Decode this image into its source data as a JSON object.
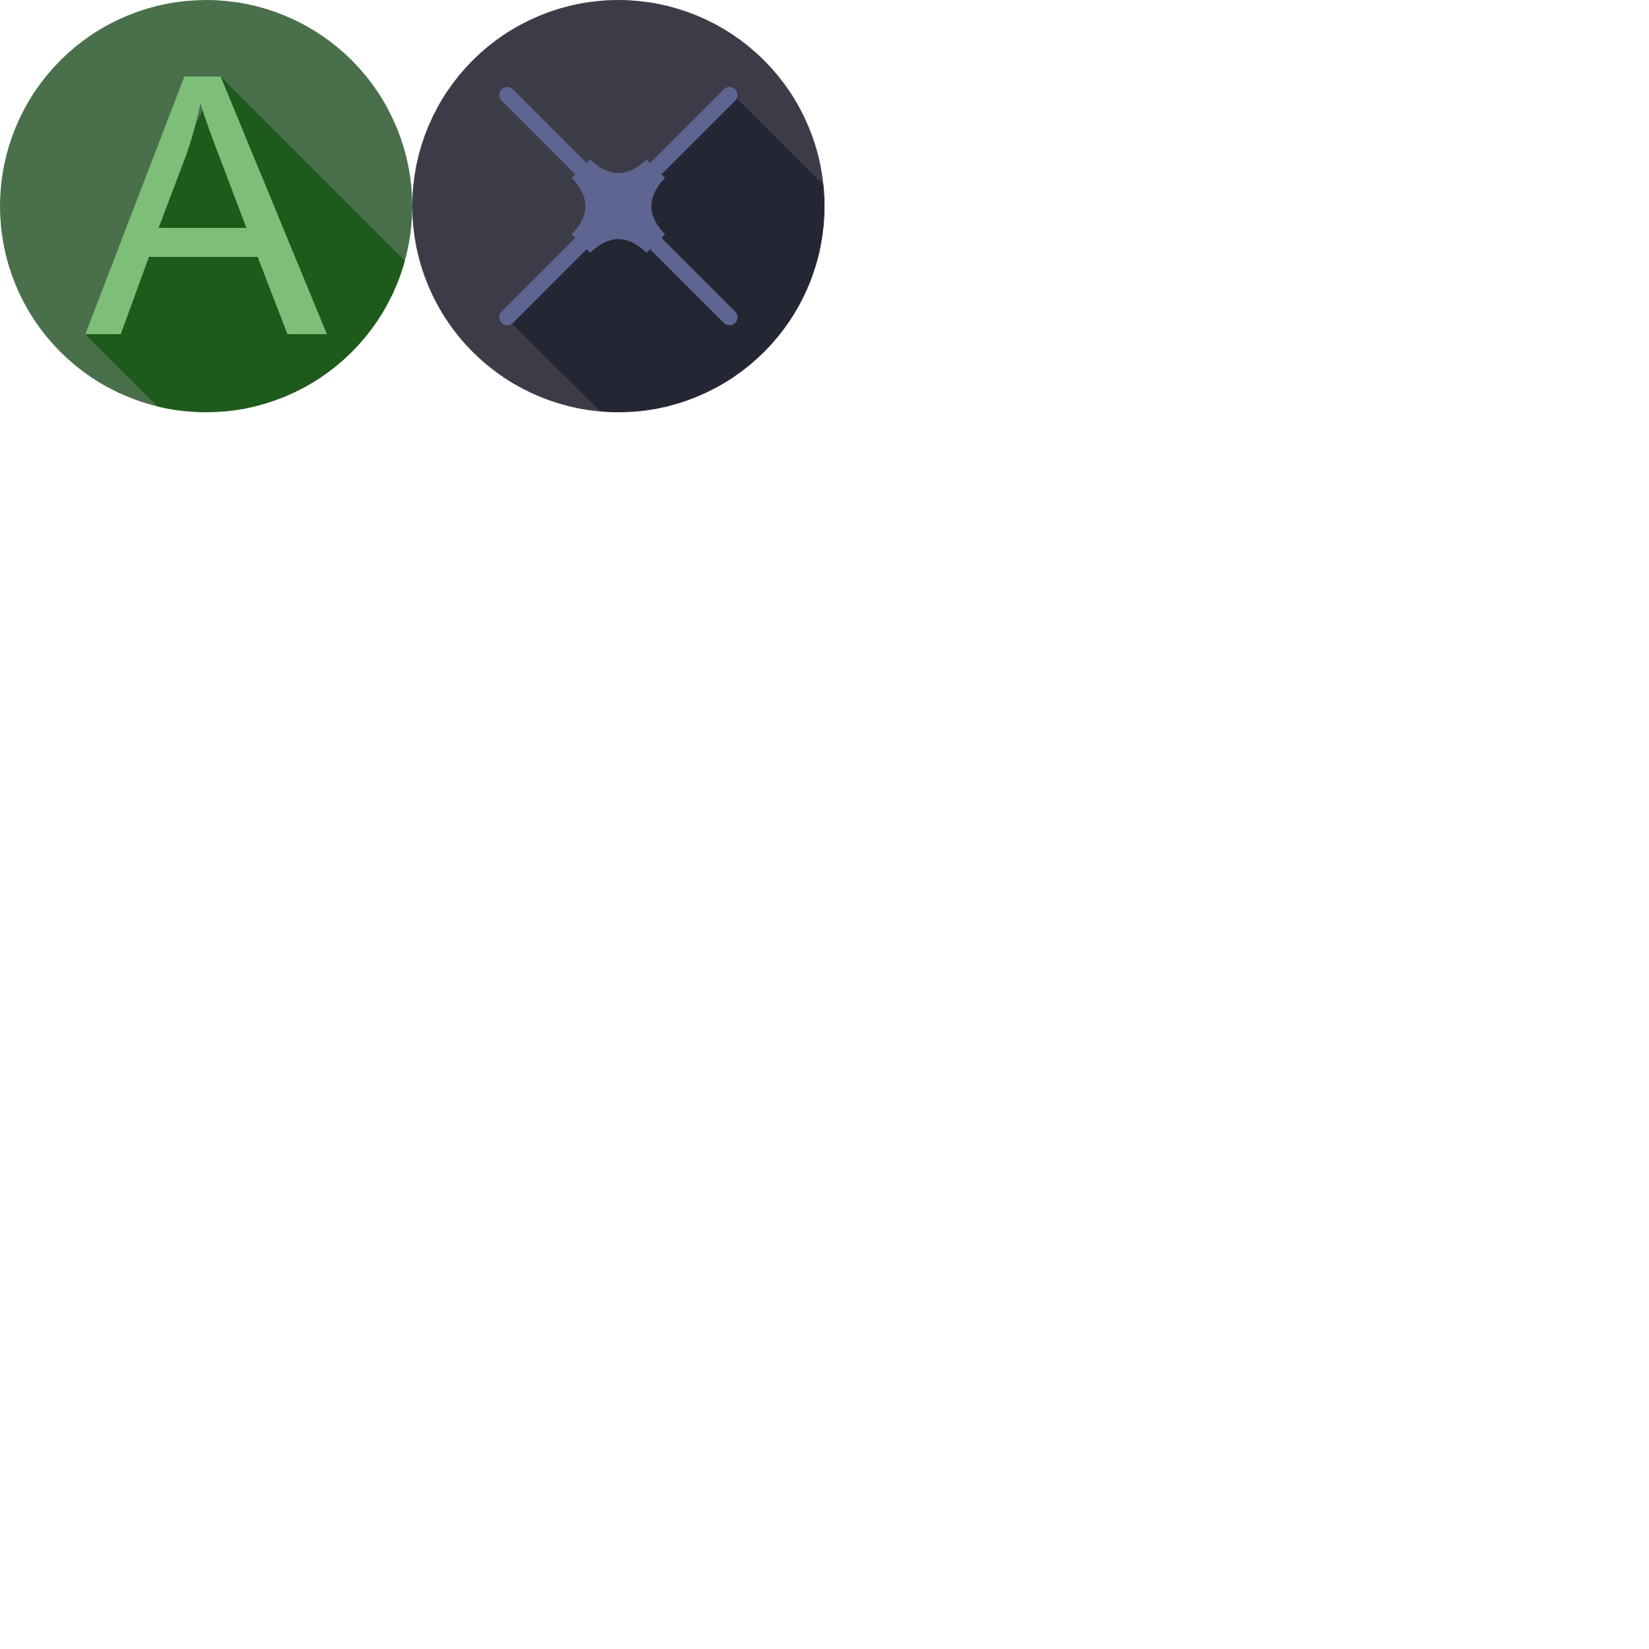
{
  "icons": [
    {
      "name": "letter-a-icon",
      "glyph": "A",
      "colors": {
        "background": "#4a6f4b",
        "shadow": "#1e5a1c",
        "foreground": "#7dbf78"
      }
    },
    {
      "name": "x-cross-icon",
      "colors": {
        "background": "#3c3c48",
        "shadow": "#252633",
        "foreground": "#5e6590"
      }
    }
  ]
}
